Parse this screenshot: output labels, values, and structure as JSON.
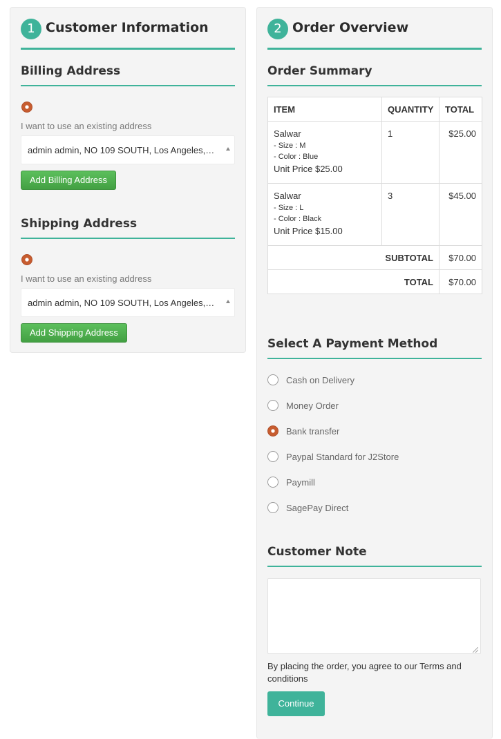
{
  "customer": {
    "step_number": "1",
    "title": "Customer Information",
    "billing": {
      "title": "Billing Address",
      "use_existing_label": "I want to use an existing address",
      "selected_address": "admin admin, NO 109 SOUTH, Los Angeles,…",
      "add_button": "Add Billing Address"
    },
    "shipping": {
      "title": "Shipping Address",
      "use_existing_label": "I want to use an existing address",
      "selected_address": "admin admin, NO 109 SOUTH, Los Angeles,…",
      "add_button": "Add Shipping Address"
    }
  },
  "order": {
    "step_number": "2",
    "title": "Order Overview",
    "summary_title": "Order Summary",
    "columns": [
      "ITEM",
      "QUANTITY",
      "TOTAL"
    ],
    "items": [
      {
        "name": "Salwar",
        "options": [
          "- Size : M",
          "- Color : Blue"
        ],
        "unit_price": "Unit Price $25.00",
        "quantity": "1",
        "total": "$25.00"
      },
      {
        "name": "Salwar",
        "options": [
          "- Size : L",
          "- Color : Black"
        ],
        "unit_price": "Unit Price $15.00",
        "quantity": "3",
        "total": "$45.00"
      }
    ],
    "subtotal_label": "SUBTOTAL",
    "subtotal_value": "$70.00",
    "total_label": "TOTAL",
    "total_value": "$70.00"
  },
  "payment": {
    "title": "Select A Payment Method",
    "methods": [
      {
        "label": "Cash on Delivery",
        "selected": false
      },
      {
        "label": "Money Order",
        "selected": false
      },
      {
        "label": "Bank transfer",
        "selected": true
      },
      {
        "label": "Paypal Standard for J2Store",
        "selected": false
      },
      {
        "label": "Paymill",
        "selected": false
      },
      {
        "label": "SagePay Direct",
        "selected": false
      }
    ]
  },
  "note": {
    "title": "Customer Note",
    "value": "",
    "agreement": "By placing the order, you agree to our Terms and conditions",
    "continue_button": "Continue"
  },
  "colors": {
    "accent": "#3fb39a",
    "button_green": "#4cae4c",
    "radio_selected": "#c75c2f"
  }
}
